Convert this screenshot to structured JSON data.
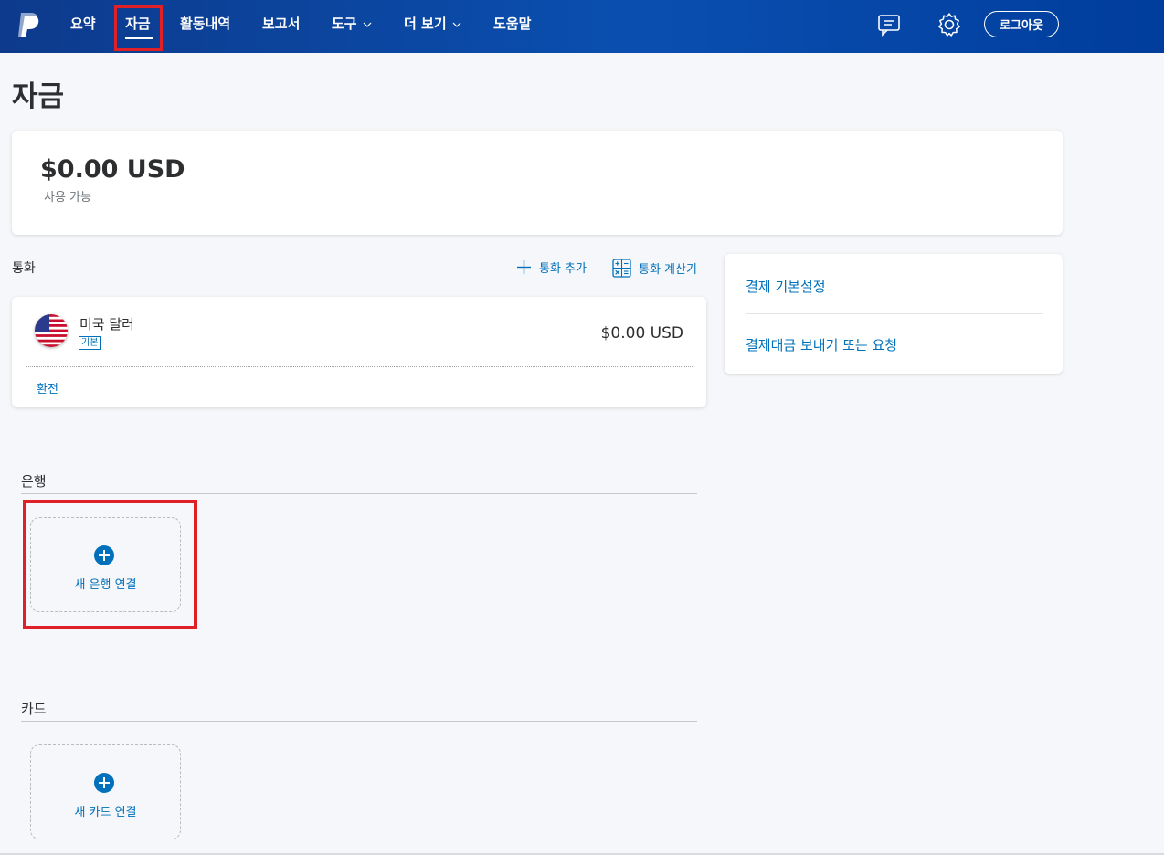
{
  "nav": {
    "logo_icon": "paypal-logo",
    "items": [
      {
        "label": "요약"
      },
      {
        "label": "자금",
        "active": true
      },
      {
        "label": "활동내역"
      },
      {
        "label": "보고서"
      },
      {
        "label": "도구",
        "dropdown": true
      },
      {
        "label": "더 보기",
        "dropdown": true
      },
      {
        "label": "도움말"
      }
    ],
    "message_icon": "message-center-icon",
    "settings_icon": "gear-icon",
    "logout_label": "로그아웃"
  },
  "page": {
    "title": "자금"
  },
  "balance": {
    "amount": "$0.00 USD",
    "subtitle": "사용 가능"
  },
  "currencies": {
    "heading": "통화",
    "add_label": "통화 추가",
    "calculator_label": "통화 계산기",
    "items": [
      {
        "name": "미국 달러",
        "badge": "기본",
        "amount": "$0.00 USD",
        "flag_icon": "us-flag-icon"
      }
    ],
    "exchange_label": "환전"
  },
  "side_links": {
    "preferences": "결제 기본설정",
    "send_request": "결제대금 보내기 또는 요청"
  },
  "banks": {
    "heading": "은행",
    "add_label": "새 은행 연결"
  },
  "cards": {
    "heading": "카드",
    "add_label": "새 카드 연결"
  },
  "colors": {
    "nav_bg": "#0a4fb0",
    "link": "#0070ba",
    "highlight": "#e02027"
  }
}
